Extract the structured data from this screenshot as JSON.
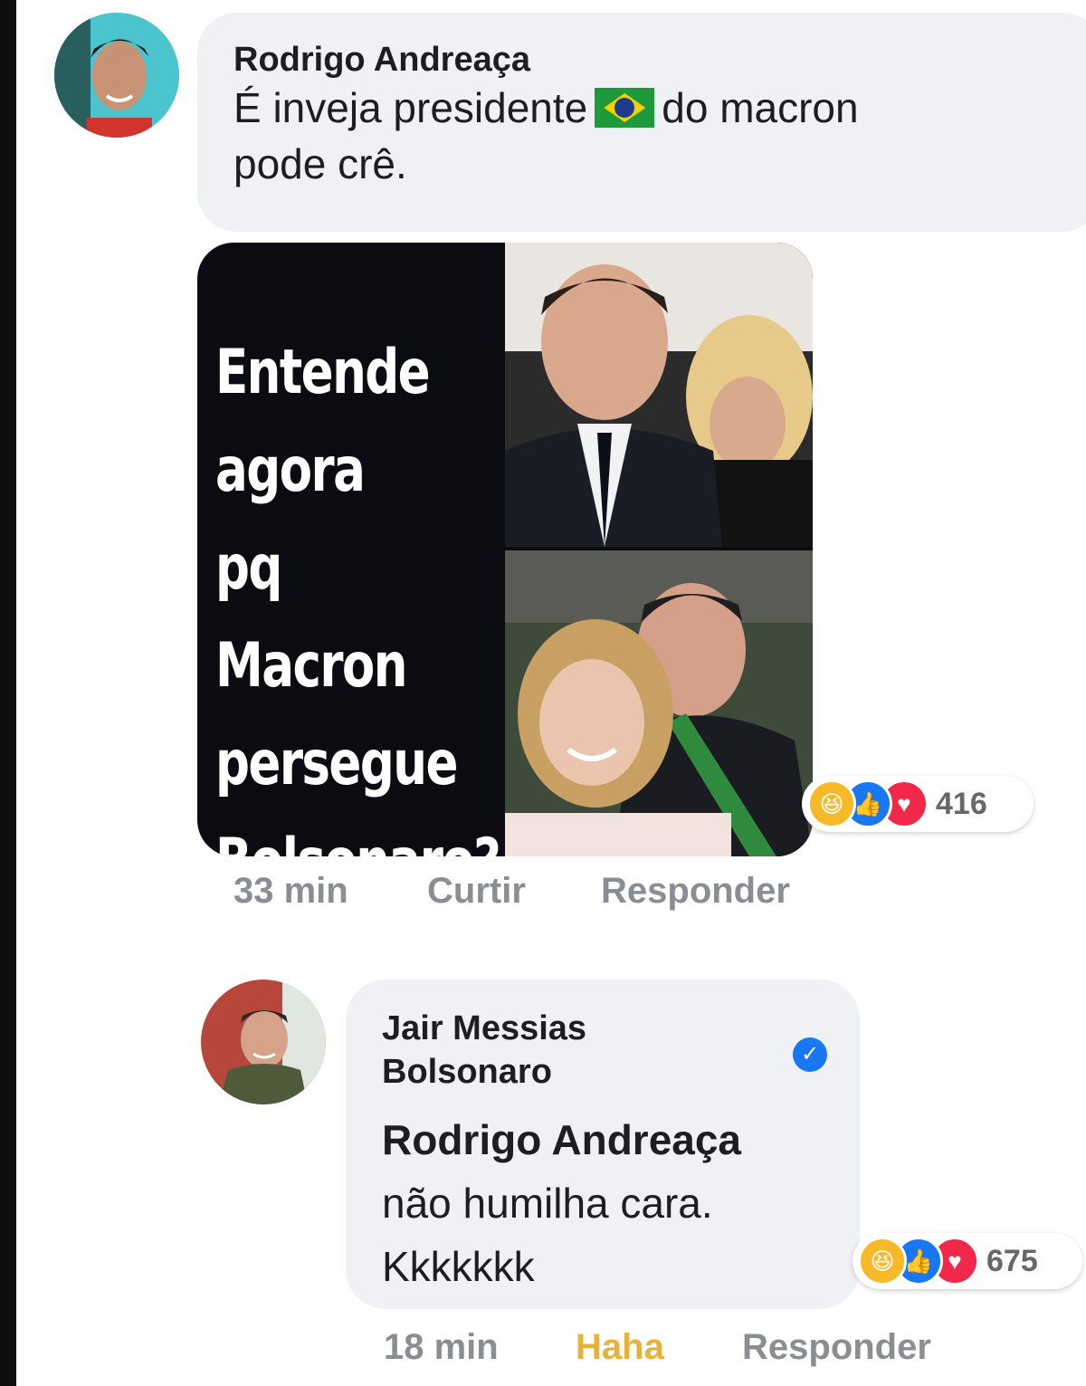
{
  "comment1": {
    "author": "Rodrigo Andreaça",
    "text_before_flag": "É inveja presidente",
    "flag_icon": "brazil-flag-icon",
    "text_after_flag": "do macron",
    "text_line2": "pode crê.",
    "meme_text": "Entende\nagora\npq Macron\npersegue\nBolsonaro?",
    "reaction_count": "416",
    "timestamp": "33 min",
    "like_label": "Curtir",
    "reply_label": "Responder"
  },
  "comment2": {
    "author_line1": "Jair Messias",
    "author_line2": "Bolsonaro",
    "mention": "Rodrigo Andreaça",
    "text_line1": "não humilha cara.",
    "text_line2": "Kkkkkkk",
    "reaction_count": "675",
    "timestamp": "18 min",
    "reaction_label": "Haha",
    "reply_label": "Responder"
  },
  "colors": {
    "bubble": "#f0f1f4",
    "haha_active": "#e8b236",
    "meta_text": "#8a8d91",
    "verified": "#1877f2"
  }
}
